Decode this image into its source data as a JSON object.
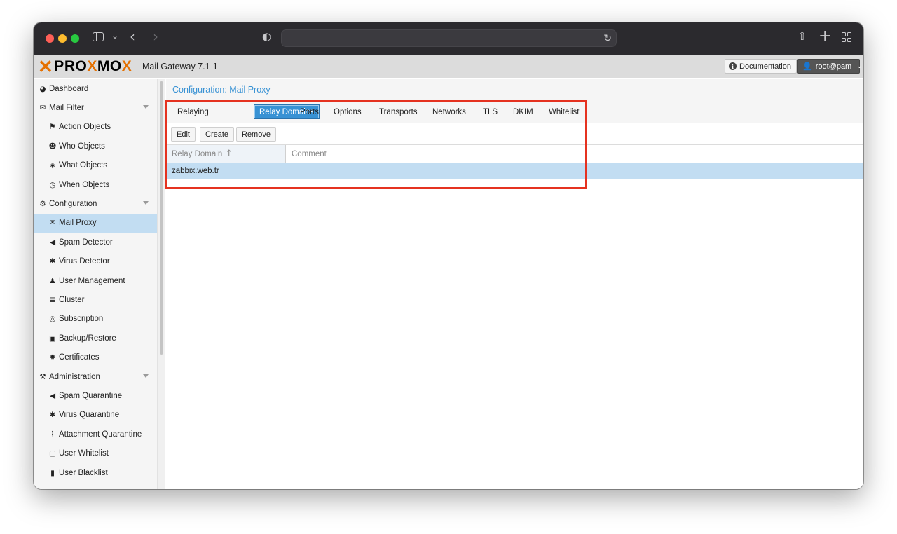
{
  "browser": {
    "url": "",
    "icons": [
      "sidebar-icon",
      "chevron-down-icon",
      "back-icon",
      "forward-icon",
      "shield-icon",
      "reload-icon",
      "share-icon",
      "new-tab-icon",
      "tab-overview-icon"
    ]
  },
  "header": {
    "logo_text": "PROXMOX",
    "product": "Mail Gateway 7.1-1",
    "doc_label": "Documentation",
    "user_label": "root@pam"
  },
  "nav": {
    "items": [
      {
        "label": "Dashboard",
        "icon": "dashboard-icon",
        "level": 1
      },
      {
        "label": "Mail Filter",
        "icon": "envelope-icon",
        "level": 1,
        "expandable": true
      },
      {
        "label": "Action Objects",
        "icon": "flag-icon",
        "level": 2
      },
      {
        "label": "Who Objects",
        "icon": "user-circle-icon",
        "level": 2
      },
      {
        "label": "What Objects",
        "icon": "cube-icon",
        "level": 2
      },
      {
        "label": "When Objects",
        "icon": "clock-icon",
        "level": 2
      },
      {
        "label": "Configuration",
        "icon": "cogs-icon",
        "level": 1,
        "expandable": true
      },
      {
        "label": "Mail Proxy",
        "icon": "envelope-outline-icon",
        "level": 2,
        "selected": true
      },
      {
        "label": "Spam Detector",
        "icon": "bullhorn-icon",
        "level": 2
      },
      {
        "label": "Virus Detector",
        "icon": "bug-icon",
        "level": 2
      },
      {
        "label": "User Management",
        "icon": "users-icon",
        "level": 2
      },
      {
        "label": "Cluster",
        "icon": "server-icon",
        "level": 2
      },
      {
        "label": "Subscription",
        "icon": "life-ring-icon",
        "level": 2
      },
      {
        "label": "Backup/Restore",
        "icon": "floppy-icon",
        "level": 2
      },
      {
        "label": "Certificates",
        "icon": "certificate-icon",
        "level": 2
      },
      {
        "label": "Administration",
        "icon": "wrench-icon",
        "level": 1,
        "expandable": true
      },
      {
        "label": "Spam Quarantine",
        "icon": "bullhorn-icon",
        "level": 2
      },
      {
        "label": "Virus Quarantine",
        "icon": "bug-icon",
        "level": 2
      },
      {
        "label": "Attachment Quarantine",
        "icon": "paperclip-icon",
        "level": 2
      },
      {
        "label": "User Whitelist",
        "icon": "file-outline-icon",
        "level": 2
      },
      {
        "label": "User Blacklist",
        "icon": "file-icon",
        "level": 2
      }
    ]
  },
  "panel": {
    "title": "Configuration: Mail Proxy",
    "tabs": [
      "Relaying",
      "Relay Domains",
      "Ports",
      "Options",
      "Transports",
      "Networks",
      "TLS",
      "DKIM",
      "Whitelist"
    ],
    "active_tab": "Relay Domains",
    "toolbar": {
      "edit": "Edit",
      "create": "Create",
      "remove": "Remove"
    },
    "columns": {
      "domain": "Relay Domain",
      "comment": "Comment"
    },
    "rows": [
      {
        "domain": "zabbix.web.tr",
        "comment": ""
      }
    ]
  },
  "colors": {
    "accent": "#3892d4",
    "selection": "#c2ddf2",
    "highlight_box": "#e53220",
    "proxmox_orange": "#e57000"
  }
}
